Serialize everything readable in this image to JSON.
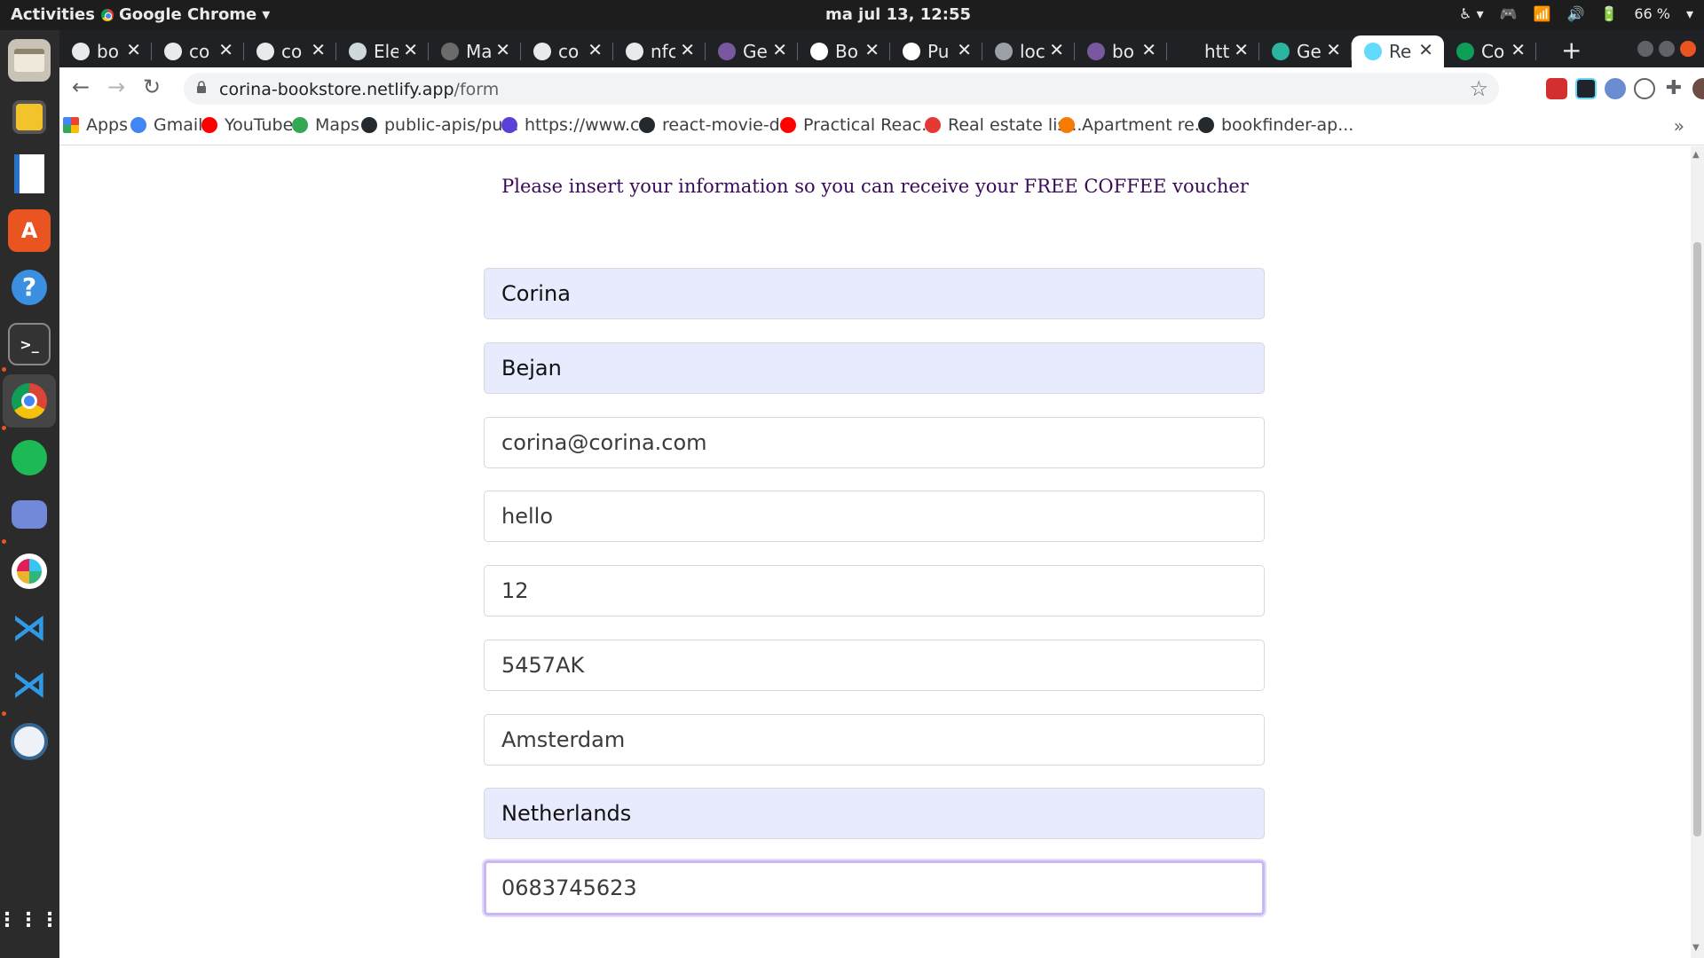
{
  "topbar": {
    "activities": "Activities",
    "app_name": "Google Chrome",
    "clock": "ma jul 13, 12:55",
    "battery": "66 %"
  },
  "dock": {
    "items": [
      "files-icon",
      "rhythmbox-icon",
      "writer-icon",
      "software-icon",
      "help-icon",
      "terminal-icon",
      "chrome-icon",
      "spotify-icon",
      "discord-icon",
      "slack-icon",
      "vscode-icon",
      "vscode-insiders-icon",
      "pgadmin-icon",
      "show-apps-icon"
    ]
  },
  "tabs": [
    {
      "label": "bo",
      "icon": "github-icon"
    },
    {
      "label": "co",
      "icon": "github-icon"
    },
    {
      "label": "co",
      "icon": "github-icon"
    },
    {
      "label": "Ele",
      "icon": "elephant-icon"
    },
    {
      "label": "Ma",
      "icon": "page-icon"
    },
    {
      "label": "co",
      "icon": "github-icon"
    },
    {
      "label": "nfc",
      "icon": "github-icon"
    },
    {
      "label": "Ge",
      "icon": "heroku-icon"
    },
    {
      "label": "Bo",
      "icon": "api-icon"
    },
    {
      "label": "Pu",
      "icon": "api-icon"
    },
    {
      "label": "loc",
      "icon": "globe-icon"
    },
    {
      "label": "bo",
      "icon": "heroku-icon"
    },
    {
      "label": "htt",
      "icon": "blank-icon"
    },
    {
      "label": "Ge",
      "icon": "gem-icon"
    },
    {
      "label": "Re",
      "icon": "react-icon",
      "active": true
    },
    {
      "label": "Co",
      "icon": "sheets-icon"
    }
  ],
  "address_bar": {
    "host": "corina-bookstore.netlify.app",
    "path": "/form"
  },
  "bookmarks": [
    {
      "label": "Apps",
      "icon": "apps-grid-icon"
    },
    {
      "label": "Gmail",
      "icon": "google-icon"
    },
    {
      "label": "YouTube",
      "icon": "youtube-icon"
    },
    {
      "label": "Maps",
      "icon": "maps-icon"
    },
    {
      "label": "public-apis/pu...",
      "icon": "github-icon"
    },
    {
      "label": "https://www.c...",
      "icon": "c-icon"
    },
    {
      "label": "react-movie-d...",
      "icon": "github-icon"
    },
    {
      "label": "Practical Reac...",
      "icon": "youtube-icon"
    },
    {
      "label": "Real estate lis...",
      "icon": "house-icon"
    },
    {
      "label": "Apartment re...",
      "icon": "orange-icon"
    },
    {
      "label": "bookfinder-ap...",
      "icon": "github-icon"
    }
  ],
  "form": {
    "intro": "Please insert your information so you can receive your FREE COFFEE voucher",
    "first_name": "Corina",
    "last_name": "Bejan",
    "email": "corina@corina.com",
    "street": "hello",
    "house_number": "12",
    "postal_code": "5457AK",
    "city": "Amsterdam",
    "country": "Netherlands",
    "phone": "0683745623"
  },
  "colors": {
    "intro_text": "#3a0a5a",
    "autofill_bg": "#e8ebfd",
    "focus_ring": "#c9b8f3"
  }
}
